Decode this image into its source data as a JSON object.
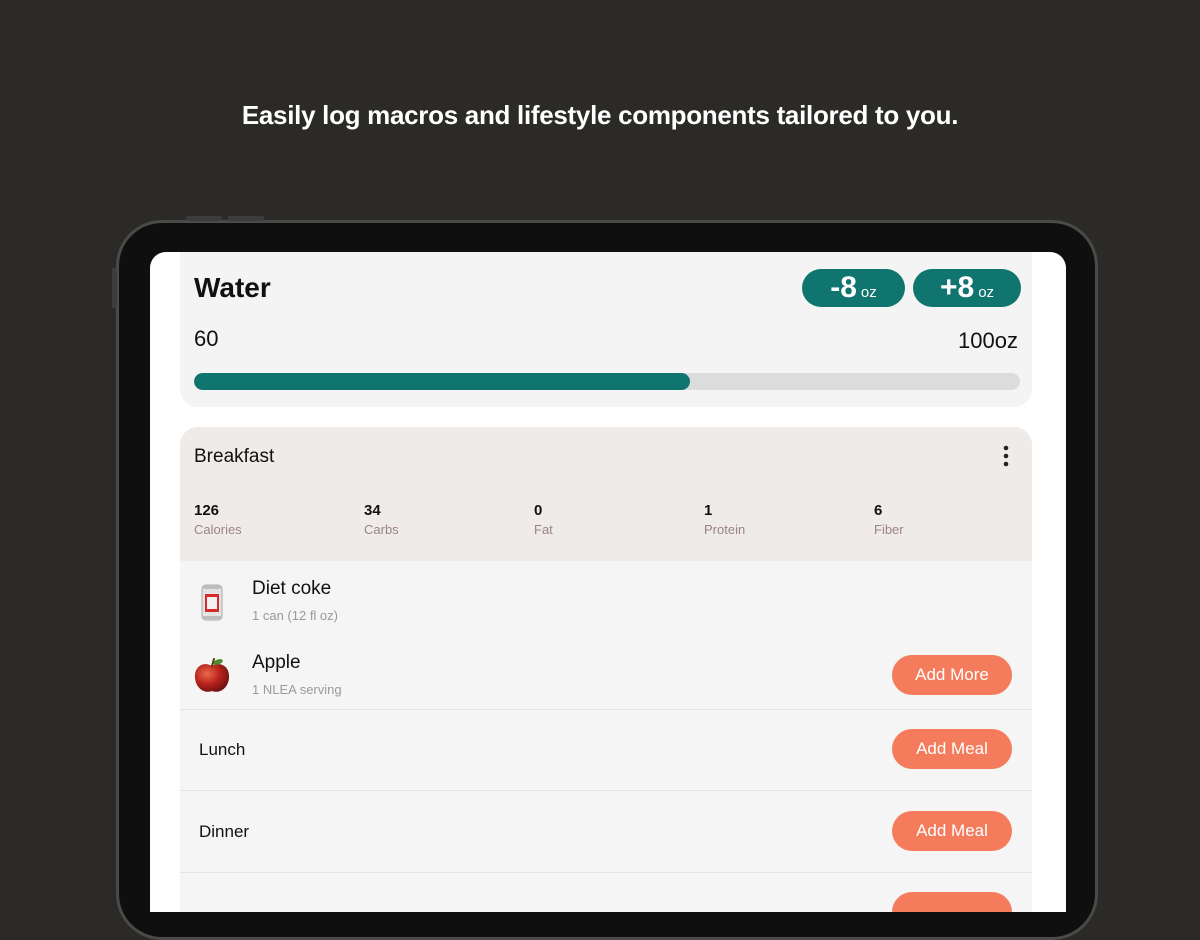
{
  "headline": "Easily log macros and lifestyle components tailored to you.",
  "colors": {
    "background": "#2b2a27",
    "accent_teal": "#11756f",
    "accent_coral": "#f47c5c"
  },
  "water": {
    "title": "Water",
    "decrement": {
      "amount": "-8",
      "unit": "oz"
    },
    "increment": {
      "amount": "+8",
      "unit": "oz"
    },
    "current": "60",
    "goal": "100oz",
    "progress_fraction": 0.6
  },
  "breakfast": {
    "title": "Breakfast",
    "macros": [
      {
        "value": "126",
        "label": "Calories"
      },
      {
        "value": "34",
        "label": "Carbs"
      },
      {
        "value": "0",
        "label": "Fat"
      },
      {
        "value": "1",
        "label": "Protein"
      },
      {
        "value": "6",
        "label": "Fiber"
      }
    ],
    "items": [
      {
        "name": "Diet coke",
        "serving": "1 can (12 fl oz)",
        "icon": "soda-can-icon"
      },
      {
        "name": "Apple",
        "serving": "1 NLEA serving",
        "icon": "apple-icon"
      }
    ],
    "add_more_label": "Add More"
  },
  "meals": [
    {
      "name": "Lunch",
      "button": "Add Meal"
    },
    {
      "name": "Dinner",
      "button": "Add Meal"
    },
    {
      "name": "",
      "button": ""
    }
  ]
}
